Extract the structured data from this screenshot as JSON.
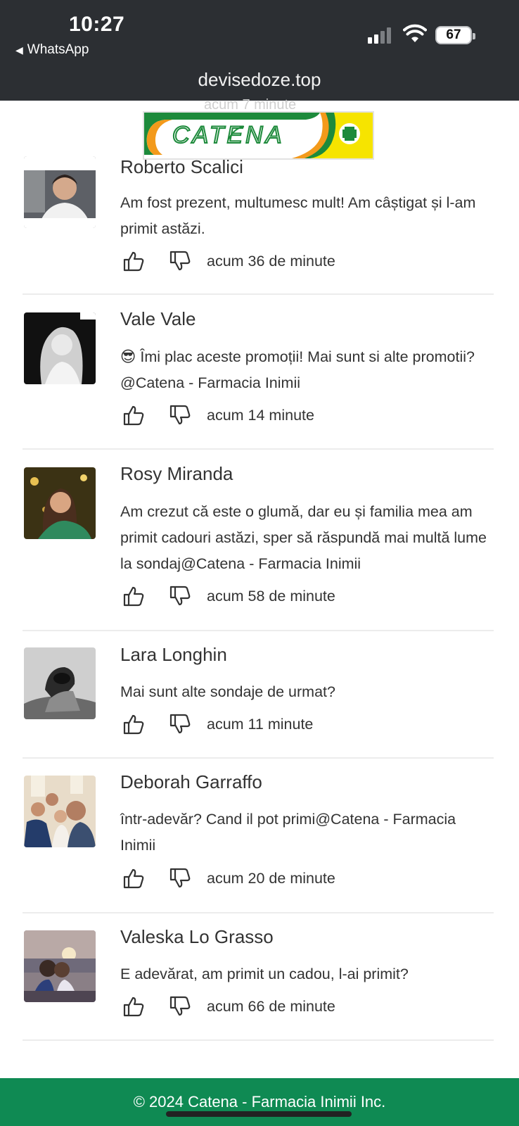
{
  "status_bar": {
    "time": "10:27",
    "back_app": "WhatsApp",
    "battery": "67",
    "url": "devisedoze.top"
  },
  "ghost_row_text": "acum 7 minute",
  "logo": {
    "text": "CATENA",
    "colors": {
      "green": "#1d8a3b",
      "orange": "#f39a1b",
      "yellow": "#f6e400"
    }
  },
  "comments": [
    {
      "author": "Roberto Scalici",
      "text": "Am fost prezent, multumesc mult! Am câștigat și l-am primit astăzi.",
      "time": "acum 36 de minute"
    },
    {
      "author": "Vale Vale",
      "text": "😎 Îmi plac aceste promoții! Mai sunt si alte promotii?@Catena - Farmacia Inimii",
      "time": "acum 14 minute"
    },
    {
      "author": "Rosy Miranda",
      "text": "Am crezut că este o glumă, dar eu și familia mea am primit cadouri astăzi, sper să răspundă mai multă lume la sondaj@Catena - Farmacia Inimii",
      "time": "acum 58 de minute"
    },
    {
      "author": "Lara Longhin",
      "text": "Mai sunt alte sondaje de urmat?",
      "time": "acum 11 minute"
    },
    {
      "author": "Deborah Garraffo",
      "text": "într-adevăr? Cand il pot primi@Catena - Farmacia Inimii",
      "time": "acum 20 de minute"
    },
    {
      "author": "Valeska Lo Grasso",
      "text": "E adevărat, am primit un cadou, l-ai primit?",
      "time": "acum 66 de minute"
    }
  ],
  "footer": {
    "text": "© 2024 Catena - Farmacia Inimii Inc."
  },
  "icons": {
    "like": "thumbs-up-icon",
    "dislike": "thumbs-down-icon"
  },
  "colors": {
    "status_bar_bg": "#2c2f33",
    "footer_bg": "#0f8a53"
  }
}
